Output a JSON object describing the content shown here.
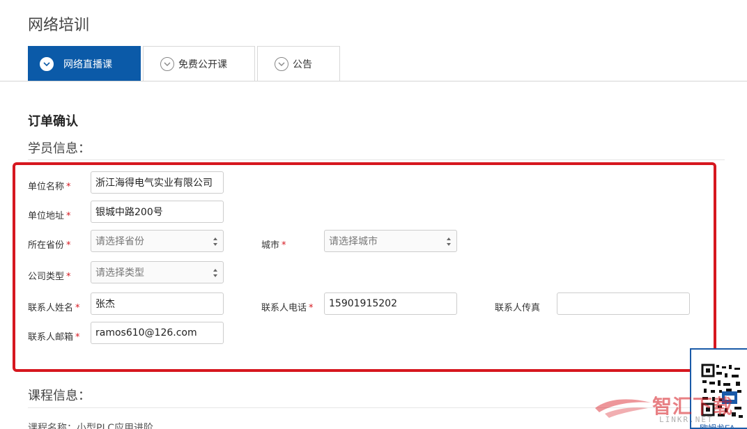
{
  "page_title": "网络培训",
  "tabs": [
    {
      "label": "网络直播课",
      "active": true
    },
    {
      "label": "免费公开课",
      "active": false
    },
    {
      "label": "公告",
      "active": false
    }
  ],
  "order_title": "订单确认",
  "student_section_title": "学员信息：",
  "form": {
    "required_mark": "*",
    "company_name": {
      "label": "单位名称",
      "value": "浙江海得电气实业有限公司"
    },
    "company_address": {
      "label": "单位地址",
      "value": "银城中路200号"
    },
    "province": {
      "label": "所在省份",
      "placeholder": "请选择省份"
    },
    "city": {
      "label": "城市",
      "placeholder": "请选择城市"
    },
    "company_type": {
      "label": "公司类型",
      "placeholder": "请选择类型"
    },
    "contact_name": {
      "label": "联系人姓名",
      "value": "张杰"
    },
    "contact_phone": {
      "label": "联系人电话",
      "value": "15901915202"
    },
    "contact_fax": {
      "label": "联系人传真",
      "value": ""
    },
    "contact_email": {
      "label": "联系人邮箱",
      "value": "ramos610@126.com"
    }
  },
  "course_section_title": "课程信息：",
  "course_name_line": "课程名称：小型PLC应用进阶",
  "qr_panel": {
    "caption": "欧姆龙FA"
  },
  "watermark": {
    "text": "智汇下载",
    "url": "LINKR.NET"
  },
  "colors": {
    "accent": "#0b5aa8",
    "highlight": "#d6171f"
  },
  "icons": {
    "tab": "chevron-down-circle-icon",
    "select": "updown-arrows-icon"
  }
}
